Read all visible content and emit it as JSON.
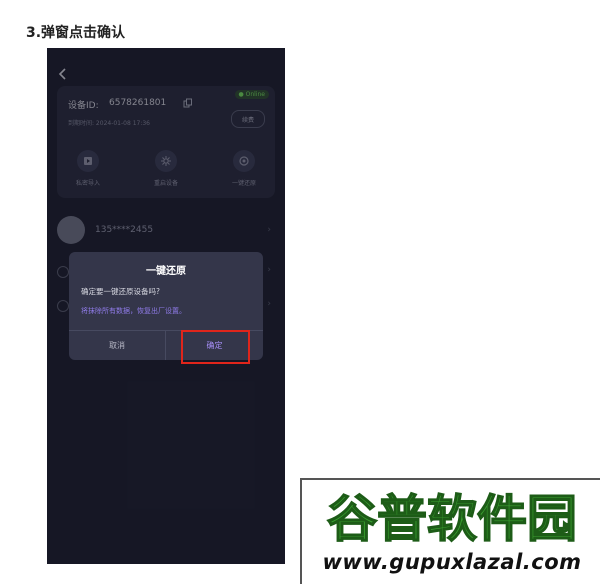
{
  "step_title": "3.弹窗点击确认",
  "device_card": {
    "badge": "● Online",
    "device_label": "设备ID:",
    "device_id": "6578261801",
    "expire": "到期时间: 2024-01-08 17:36",
    "renew": "续费",
    "actions": [
      {
        "label": "私密导入",
        "icon": "play-icon"
      },
      {
        "label": "重启设备",
        "icon": "gear-icon"
      },
      {
        "label": "一键还原",
        "icon": "reset-icon"
      }
    ]
  },
  "user": {
    "phone": "135****2455"
  },
  "modal": {
    "title": "一键还原",
    "question": "确定要一键还原设备吗?",
    "note": "将抹除所有数据，恢复出厂设置。",
    "cancel": "取消",
    "confirm": "确定"
  },
  "watermark": {
    "brand": "谷普软件园",
    "url": "www.gupuxlazal.com"
  },
  "colors": {
    "phone_bg": "#1e2030",
    "modal_bg": "#34364a",
    "accent": "#a48df5",
    "highlight": "#e0251b",
    "brand_green": "#3aa130"
  }
}
